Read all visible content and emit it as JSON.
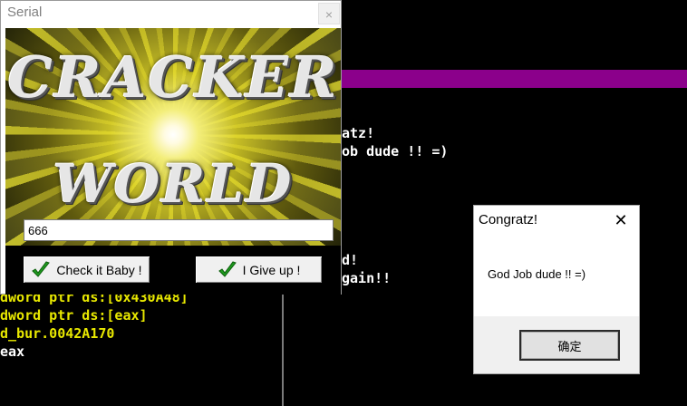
{
  "serial_window": {
    "title": "Serial",
    "close_glyph": "×",
    "banner_line1": "CRACKER",
    "banner_line2": "WORLD",
    "serial_value": "666",
    "check_button_label": "Check it Baby !",
    "giveup_button_label": "I Give up !"
  },
  "congratz_dialog": {
    "title": "Congratz!",
    "close_glyph": "✕",
    "message": "God Job dude !! =)",
    "ok_label": "确定"
  },
  "background_code": {
    "right_lines": [
      "atz!",
      "ob dude !! =)",
      "d!",
      "gain!!"
    ],
    "left_lines": [
      "dword ptr ds:[0x430A48]",
      "dword ptr ds:[eax]",
      "d_bur.0042A170",
      "eax"
    ]
  },
  "colors": {
    "purple_bar": "#8b008b",
    "check_green": "#1f9a1f"
  }
}
